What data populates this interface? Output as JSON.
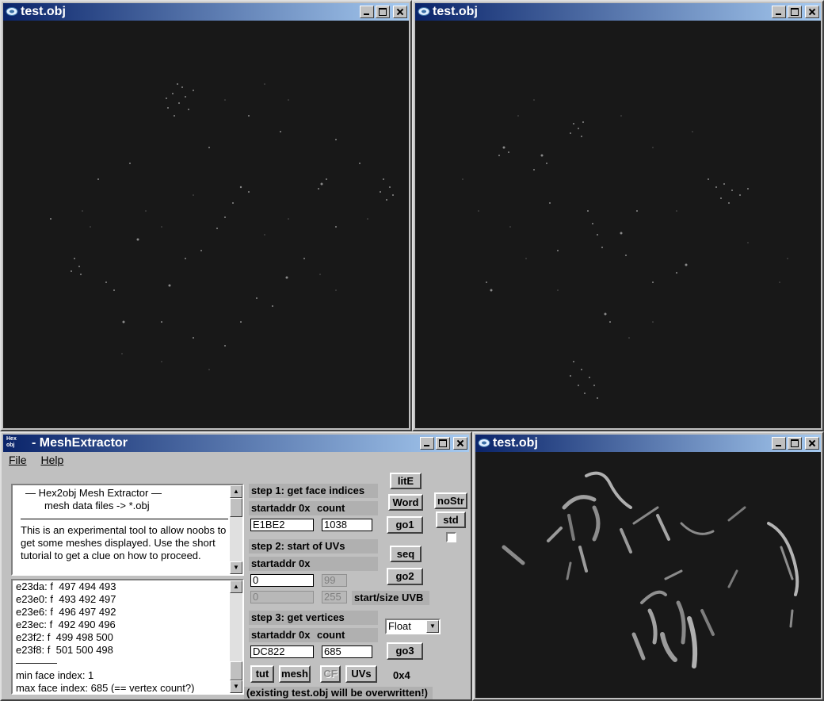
{
  "windows": {
    "view1": {
      "title": "test.obj"
    },
    "view2": {
      "title": "test.obj"
    },
    "view3": {
      "title": "test.obj"
    }
  },
  "mesh_extractor": {
    "title": "- MeshExtractor",
    "app_icon_text": "Hex obj",
    "menu": {
      "file": "File",
      "help": "Help"
    },
    "intro": {
      "line1": "—   Hex2obj Mesh Extractor   —",
      "line2": "mesh data files -> *.obj",
      "para": "This is an experimental tool to allow noobs to get some meshes displayed. Use the short tutorial to get a clue on how to proceed."
    },
    "log": {
      "lines": [
        "e23da: f  497 494 493",
        "e23e0: f  493 492 497",
        "e23e6: f  496 497 492",
        "e23ec: f  492 490 496",
        "e23f2: f  499 498 500",
        "e23f8: f  501 500 498",
        "————",
        "min face index: 1",
        "max face index: 685 (== vertex count?)"
      ]
    },
    "step1": {
      "label": "step 1: get face indices",
      "startaddr_label": "startaddr 0x",
      "count_label": "count",
      "startaddr": "E1BE2",
      "count": "1038",
      "go": "go1"
    },
    "step2": {
      "label": "step 2: start of UVs",
      "startaddr_label": "startaddr 0x",
      "startaddr": "0",
      "field2": "99",
      "field3": "0",
      "field4": "255",
      "uvb_label": "start/size UVB",
      "go": "go2"
    },
    "step3": {
      "label": "step 3: get vertices",
      "startaddr_label": "startaddr 0x",
      "count_label": "count",
      "startaddr": "DC822",
      "count": "685",
      "go": "go3",
      "type": "Float",
      "stride": "0x4"
    },
    "buttons": {
      "lite": "litE",
      "word": "Word",
      "seq": "seq",
      "nostr": "noStr",
      "std": "std",
      "tut": "tut",
      "mesh": "mesh",
      "cf": "CF",
      "uvs": "UVs"
    },
    "footer": "(existing test.obj will be overwritten!)"
  },
  "colors": {
    "titlebar_start": "#0a246a",
    "titlebar_end": "#a6caf0",
    "viewport_bg": "#181818",
    "label_bg": "#b0b0b0"
  }
}
